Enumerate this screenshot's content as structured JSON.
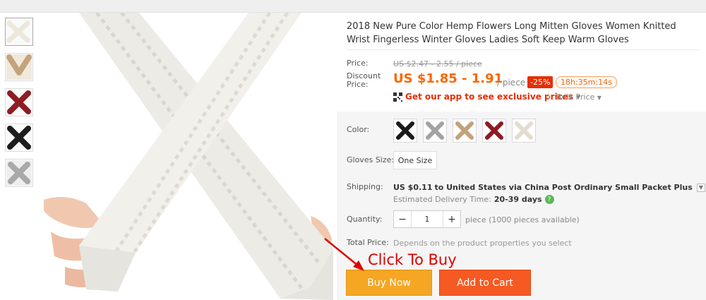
{
  "product": {
    "title": "2018 New Pure Color Hemp Flowers Long Mitten Gloves Women Knitted Wrist Fingerless Winter Gloves Ladies Soft Keep Warm Gloves"
  },
  "price": {
    "label": "Price:",
    "original": "US $2.47 - 2.55 / piece",
    "discount_label": "Discount Price:",
    "discount_value": "US $1.85 - 1.91",
    "unit": "/ piece",
    "discount_badge": "-25%",
    "countdown": "18h:35m:14s",
    "app_promo": "Get our app to see exclusive prices",
    "bulk_price": "Bulk Price"
  },
  "options": {
    "color_label": "Color:",
    "colors": [
      "black",
      "gray",
      "khaki",
      "wine-red",
      "beige"
    ],
    "size_label": "Gloves Size:",
    "size_value": "One Size"
  },
  "shipping": {
    "label": "Shipping:",
    "cost": "US $0.11",
    "to_text": "to United States via China Post Ordinary Small Packet Plus",
    "estimate_label": "Estimated Delivery Time:",
    "estimate_value": "20-39 days"
  },
  "quantity": {
    "label": "Quantity:",
    "value": "1",
    "minus": "−",
    "plus": "+",
    "note": "piece (1000 pieces available)"
  },
  "total": {
    "label": "Total Price:",
    "note": "Depends on the product properties you select"
  },
  "annotation": {
    "text": "Click To Buy"
  },
  "buttons": {
    "buy_now": "Buy Now",
    "add_to_cart": "Add to Cart"
  },
  "thumbnails": [
    "beige",
    "khaki",
    "wine-red",
    "black",
    "gray"
  ],
  "colors": {
    "accent_orange": "#f60",
    "buy_now_bg": "#f5a623",
    "add_cart_bg": "#f65a23",
    "discount_badge_bg": "#e62e04",
    "annotation_red": "#e00000"
  }
}
